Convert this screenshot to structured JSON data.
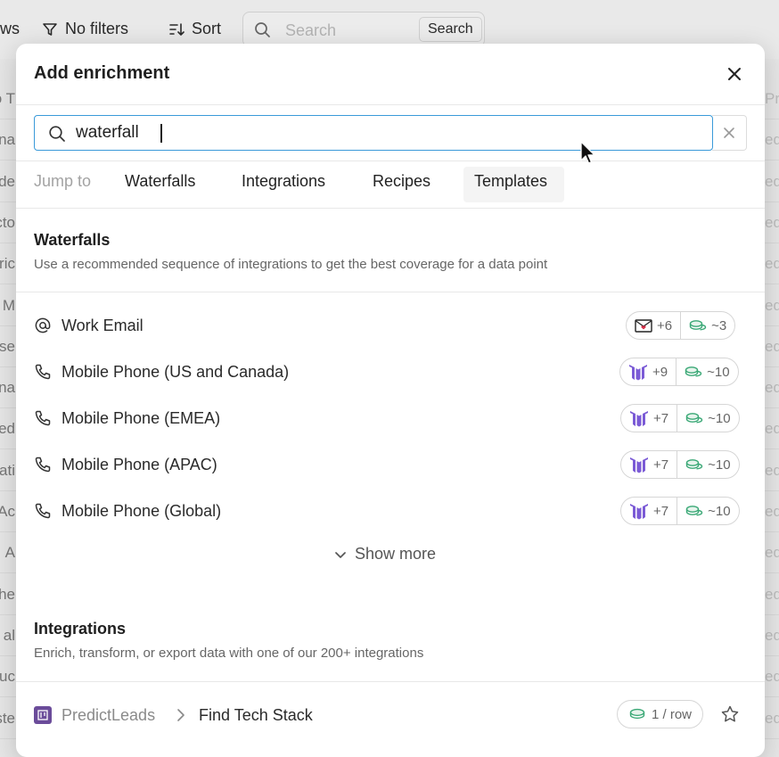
{
  "background": {
    "toolbar": {
      "views_fragment": "ws",
      "filter_label": "No filters",
      "sort_label": "Sort",
      "search_placeholder": "Search",
      "search_button": "Search"
    },
    "left_fragments": [
      "o T",
      "na",
      "de",
      "cto",
      "ric",
      "M",
      "se",
      "na",
      "ed",
      "ati",
      "Ac",
      "A",
      "he",
      "al",
      "uc",
      "ste"
    ],
    "right_fragments": [
      "Pr",
      "ed",
      "ed",
      "ed",
      "ed",
      "ed",
      "ed",
      "ed",
      "ed",
      "ed",
      "ed",
      "ed",
      "ed",
      "ed",
      "ed",
      "ed"
    ]
  },
  "modal": {
    "title": "Add enrichment",
    "search": {
      "value": "waterfall",
      "placeholder": ""
    },
    "jump_to": {
      "label": "Jump to",
      "tabs": [
        "Waterfalls",
        "Integrations",
        "Recipes",
        "Templates"
      ],
      "active": "Templates"
    },
    "waterfalls": {
      "title": "Waterfalls",
      "description": "Use a recommended sequence of integrations to get the best coverage for a data point",
      "items": [
        {
          "icon": "at-icon",
          "label": "Work Email",
          "providers": "+6",
          "credits": "~3",
          "provider_icon": "email-icon"
        },
        {
          "icon": "phone-icon",
          "label": "Mobile Phone (US and Canada)",
          "providers": "+9",
          "credits": "~10",
          "provider_icon": "waterfall-logo-icon"
        },
        {
          "icon": "phone-icon",
          "label": "Mobile Phone (EMEA)",
          "providers": "+7",
          "credits": "~10",
          "provider_icon": "waterfall-logo-icon"
        },
        {
          "icon": "phone-icon",
          "label": "Mobile Phone (APAC)",
          "providers": "+7",
          "credits": "~10",
          "provider_icon": "waterfall-logo-icon"
        },
        {
          "icon": "phone-icon",
          "label": "Mobile Phone (Global)",
          "providers": "+7",
          "credits": "~10",
          "provider_icon": "waterfall-logo-icon"
        }
      ],
      "show_more": "Show more"
    },
    "integrations": {
      "title": "Integrations",
      "description": "Enrich, transform, or export data with one of our 200+ integrations",
      "items": [
        {
          "provider": "PredictLeads",
          "action": "Find Tech Stack",
          "credits": "1 / row"
        }
      ]
    },
    "colors": {
      "focus_border": "#3a9ad9",
      "provider_purple": "#6b4c9a",
      "credit_green": "#3aa876"
    }
  }
}
